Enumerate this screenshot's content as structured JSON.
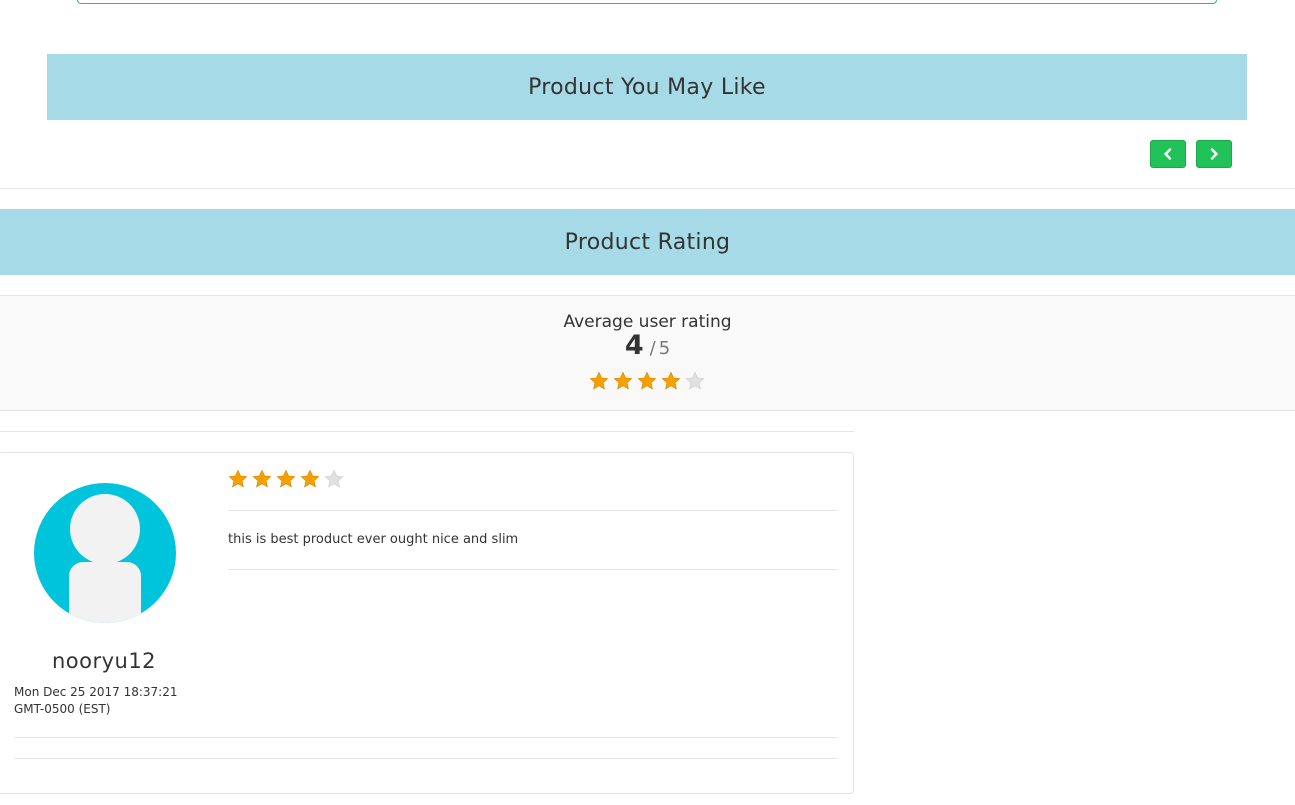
{
  "sections": {
    "may_like_title": "Product You May Like",
    "rating_title": "Product Rating"
  },
  "carousel": {
    "prev_icon": "chevron-left-icon",
    "next_icon": "chevron-right-icon",
    "button_color": "#22c25a"
  },
  "average": {
    "label": "Average user rating",
    "score": "4",
    "separator": "/",
    "max": "5",
    "stars_filled": 4,
    "stars_total": 5
  },
  "review": {
    "avatar_icon": "user-avatar-icon",
    "username": "nooryu12",
    "date": "Mon Dec 25 2017 18:37:21 GMT-0500 (EST)",
    "stars_filled": 4,
    "stars_total": 5,
    "text": "this is best product ever ought nice and slim"
  },
  "colors": {
    "banner": "#a6dae6",
    "avatar_bg": "#00c4dc",
    "star_filled": "#f6a000",
    "star_empty": "#e0e0e0"
  }
}
